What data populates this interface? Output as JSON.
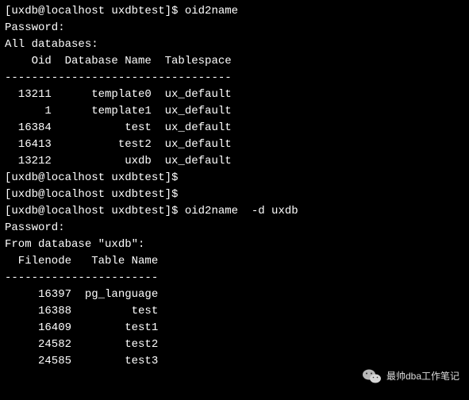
{
  "terminal": {
    "lines": {
      "l0": "[uxdb@localhost uxdbtest]$ oid2name",
      "l1": "Password:",
      "l2": "All databases:",
      "l3": "    Oid  Database Name  Tablespace",
      "l4": "----------------------------------",
      "l5": "  13211      template0  ux_default",
      "l6": "      1      template1  ux_default",
      "l7": "  16384           test  ux_default",
      "l8": "  16413          test2  ux_default",
      "l9": "  13212           uxdb  ux_default",
      "l10": "[uxdb@localhost uxdbtest]$",
      "l11": "[uxdb@localhost uxdbtest]$",
      "l12": "[uxdb@localhost uxdbtest]$ oid2name  -d uxdb",
      "l13": "Password:",
      "l14": "From database \"uxdb\":",
      "l15": "  Filenode   Table Name",
      "l16": "-----------------------",
      "l17": "     16397  pg_language",
      "l18": "     16388         test",
      "l19": "     16409        test1",
      "l20": "     24582        test2",
      "l21": "     24585        test3"
    }
  },
  "watermark": {
    "text": "最帅dba工作笔记"
  }
}
